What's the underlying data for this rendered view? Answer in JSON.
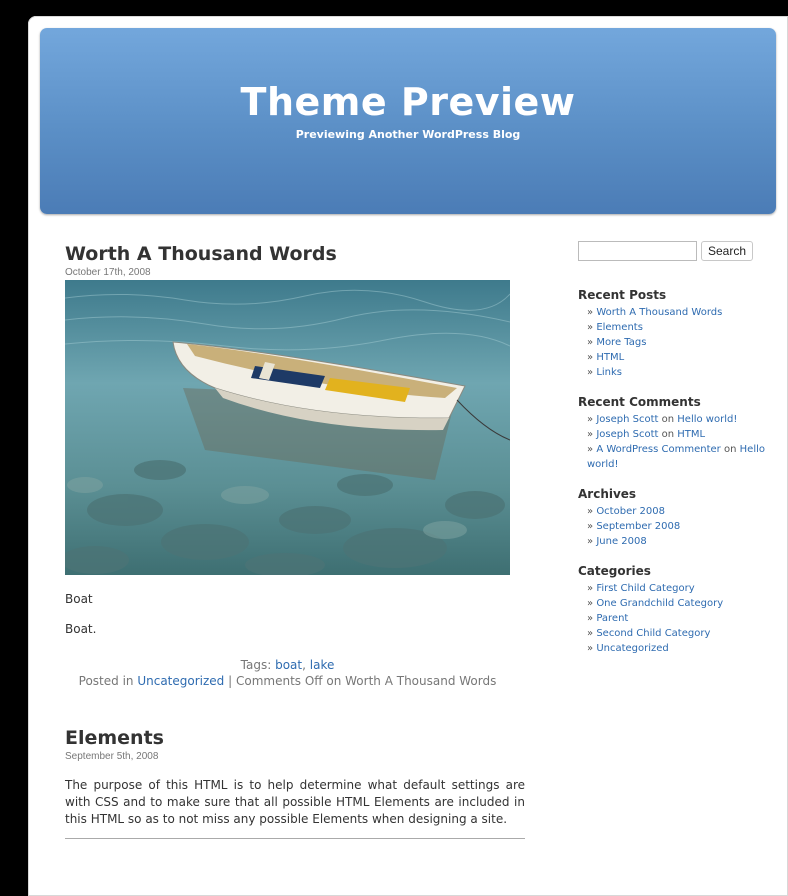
{
  "header": {
    "title": "Theme Preview",
    "description": "Previewing Another WordPress Blog"
  },
  "posts": [
    {
      "title": "Worth A Thousand Words",
      "date": "October 17th, 2008",
      "image_alt": "Boat",
      "caption": "Boat",
      "body": "Boat.",
      "tags_label": "Tags:",
      "tags": [
        "boat",
        "lake"
      ],
      "posted_in_label": "Posted in",
      "category": "Uncategorized",
      "comments": "Comments Off on Worth A Thousand Words"
    },
    {
      "title": "Elements",
      "date": "September 5th, 2008",
      "body": "The purpose of this HTML is to help determine what default settings are with CSS and to make sure that all possible HTML Elements are included in this HTML so as to not miss any possible Elements when designing a site."
    }
  ],
  "sidebar": {
    "search": {
      "value": "",
      "button_label": "Search"
    },
    "recent_posts": {
      "title": "Recent Posts",
      "items": [
        "Worth A Thousand Words",
        "Elements",
        "More Tags",
        "HTML",
        "Links"
      ]
    },
    "recent_comments": {
      "title": "Recent Comments",
      "items": [
        {
          "author": "Joseph Scott",
          "on": "on",
          "post": "Hello world!"
        },
        {
          "author": "Joseph Scott",
          "on": "on",
          "post": "HTML"
        },
        {
          "author": "A WordPress Commenter",
          "on": "on",
          "post": "Hello world!"
        }
      ]
    },
    "archives": {
      "title": "Archives",
      "items": [
        "October 2008",
        "September 2008",
        "June 2008"
      ]
    },
    "categories": {
      "title": "Categories",
      "items": [
        "First Child Category",
        "One Grandchild Category",
        "Parent",
        "Second Child Category",
        "Uncategorized"
      ]
    },
    "bullet": "»"
  },
  "colors": {
    "header_top": "#73a7dc",
    "header_bottom": "#4b7cb6",
    "link": "#2e6bb0"
  }
}
